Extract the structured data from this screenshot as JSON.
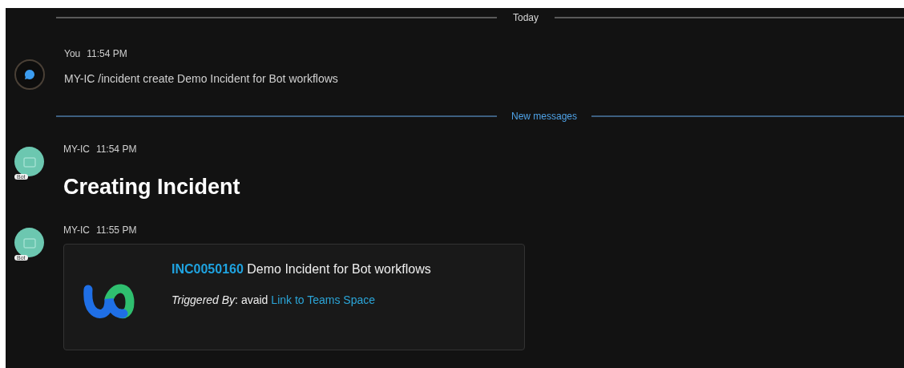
{
  "feed": [
    {
      "kind": "divider",
      "label": "Today",
      "emphasis": false
    },
    {
      "kind": "message",
      "bot": false,
      "sender": "You",
      "time": "11:54 PM",
      "text": "MY-IC /incident create Demo Incident for Bot workflows"
    },
    {
      "kind": "divider",
      "label": "New messages",
      "emphasis": true
    },
    {
      "kind": "message",
      "bot": true,
      "badge": "Bot",
      "sender": "MY-IC",
      "time": "11:54 PM",
      "heading": "Creating Incident"
    },
    {
      "kind": "message",
      "bot": true,
      "badge": "Bot",
      "sender": "MY-IC",
      "time": "11:55 PM",
      "card": {
        "id": "INC0050160",
        "title": "Demo Incident for Bot workflows",
        "triggered": "*Triggered By*: avaid",
        "link": "Link to Teams Space"
      }
    }
  ]
}
